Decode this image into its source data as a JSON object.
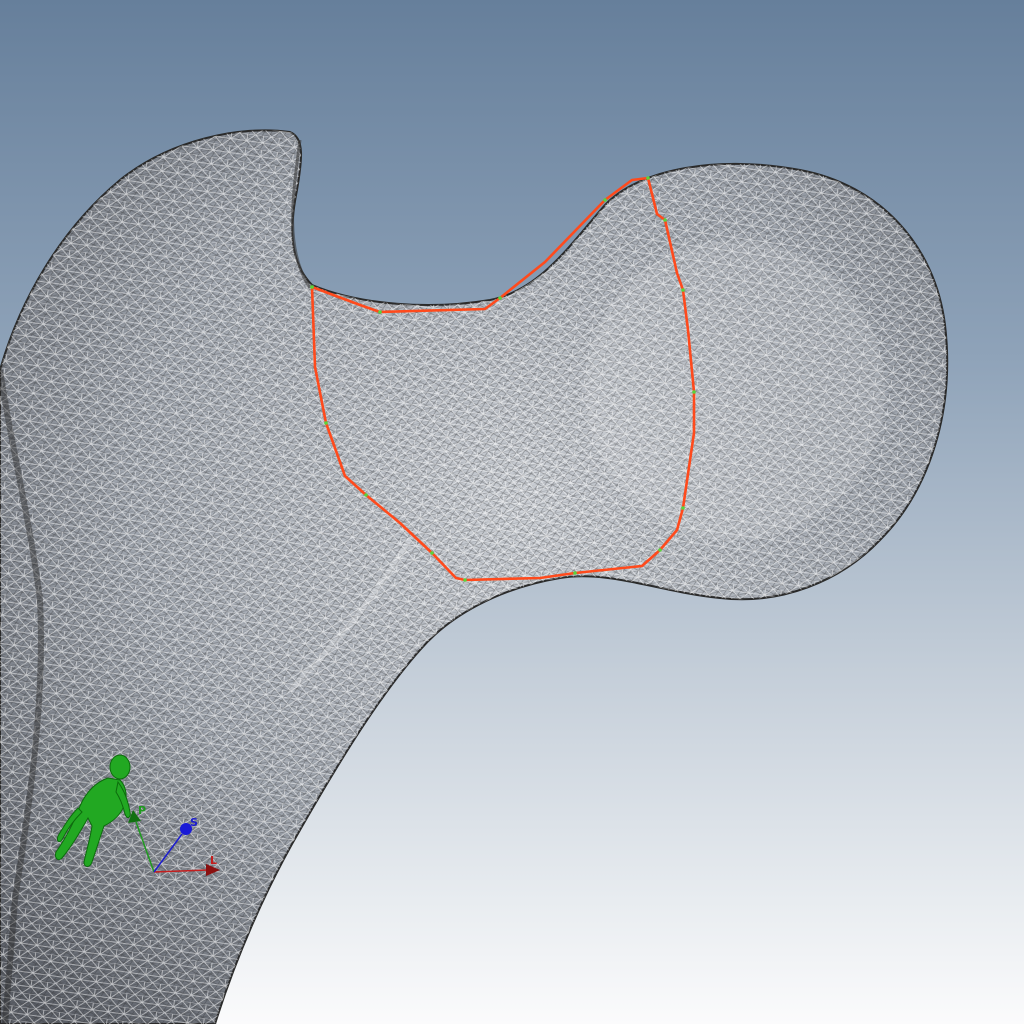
{
  "viewer": {
    "background_top": "#667f9b",
    "background_bottom": "#fbfbfc",
    "mesh_color": "#3c3c3c",
    "mesh_highlight": "#ffffff",
    "selection_outline_color": "#ff4a1c",
    "selection_vertex_color": "#5ad23c"
  },
  "orientation_marker": {
    "figure_color": "#22a822",
    "axes": [
      {
        "name": "x",
        "label": "L",
        "color": "#c41e1e"
      },
      {
        "name": "y",
        "label": "P",
        "color": "#1f9a1f"
      },
      {
        "name": "z",
        "label": "S",
        "color": "#1c1ccc"
      }
    ]
  }
}
